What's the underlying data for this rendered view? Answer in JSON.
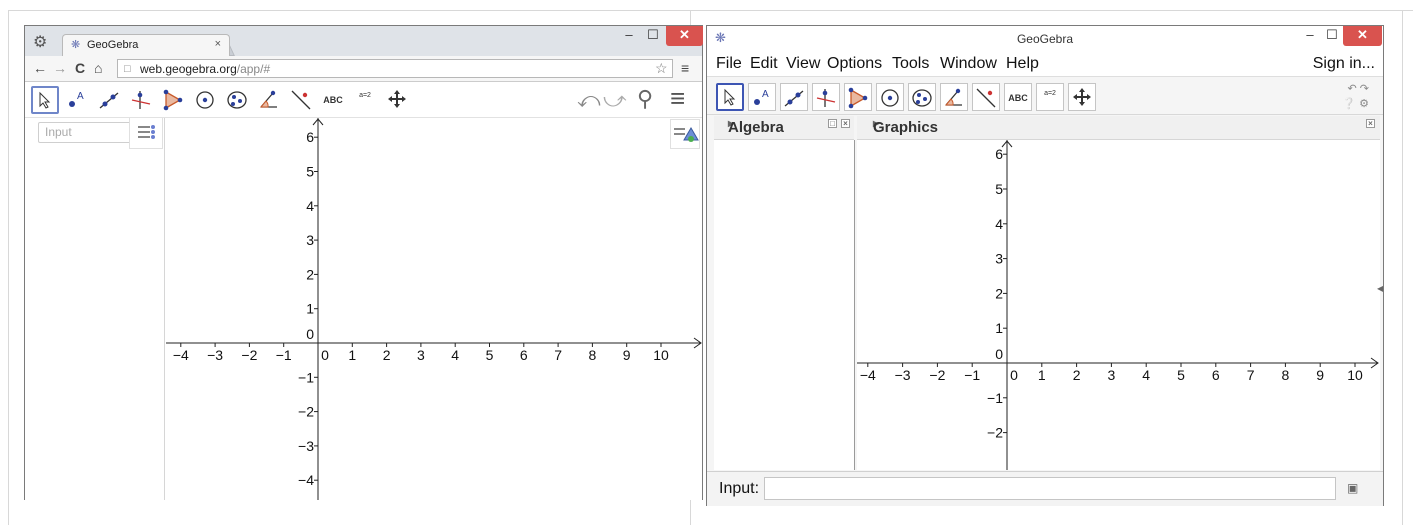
{
  "browser": {
    "tab_title": "GeoGebra",
    "tab_close": "×",
    "url_main": "web.geogebra.org",
    "url_path": "/app/#",
    "input_placeholder": "Input"
  },
  "app": {
    "window_title": "GeoGebra",
    "menu": [
      "File",
      "Edit",
      "View",
      "Options",
      "Tools",
      "Window",
      "Help"
    ],
    "sign_in": "Sign in...",
    "algebra_header": "Algebra",
    "graphics_header": "Graphics",
    "input_label": "Input:",
    "input_value": ""
  },
  "tools": {
    "text_tool": "ABC",
    "slider_tool": "a=2"
  },
  "window_controls": {
    "minimize": "–",
    "maximize": "☐",
    "close": "✕"
  },
  "icons": [
    "incognito-icon",
    "back-icon",
    "forward-icon",
    "reload-icon",
    "home-icon",
    "page-icon",
    "star-icon",
    "menu-icon",
    "undo-icon",
    "redo-icon",
    "search-icon",
    "hamburger-icon",
    "algebra-menu-icon",
    "graphics-style-icon",
    "geogebra-logo-icon",
    "help-icon",
    "settings-icon",
    "input-help-icon"
  ],
  "graphs": {
    "browser_x_ticks": [
      -4,
      -3,
      -2,
      -1,
      0,
      1,
      2,
      3,
      4,
      5,
      6,
      7,
      8,
      9,
      10
    ],
    "browser_y_ticks": [
      6,
      5,
      4,
      3,
      2,
      1,
      0,
      -1,
      -2,
      -3,
      -4
    ],
    "app_x_ticks": [
      -4,
      -3,
      -2,
      -1,
      0,
      1,
      2,
      3,
      4,
      5,
      6,
      7,
      8,
      9,
      10
    ],
    "app_y_ticks": [
      6,
      5,
      4,
      3,
      2,
      1,
      0,
      -1,
      -2
    ]
  }
}
